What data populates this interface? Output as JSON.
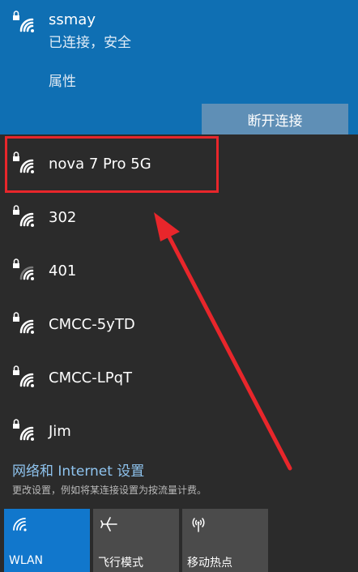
{
  "connected": {
    "name": "ssmay",
    "status": "已连接，安全",
    "properties_label": "属性",
    "disconnect_label": "断开连接"
  },
  "networks": [
    {
      "name": "nova 7 Pro 5G",
      "icon": "wifi-lock-icon"
    },
    {
      "name": "302",
      "icon": "wifi-lock-icon"
    },
    {
      "name": "401",
      "icon": "wifi-lock-icon"
    },
    {
      "name": "CMCC-5yTD",
      "icon": "wifi-lock-icon"
    },
    {
      "name": "CMCC-LPqT",
      "icon": "wifi-lock-icon"
    },
    {
      "name": "Jim",
      "icon": "wifi-lock-icon"
    }
  ],
  "settings": {
    "link": "网络和 Internet 设置",
    "description": "更改设置，例如将某连接设置为按流量计费。"
  },
  "quick_actions": [
    {
      "label": "WLAN",
      "icon": "wifi-icon",
      "active": true
    },
    {
      "label": "飞行模式",
      "icon": "airplane-icon",
      "active": false
    },
    {
      "label": "移动热点",
      "icon": "hotspot-icon",
      "active": false
    }
  ],
  "colors": {
    "accent": "#0f6fb3",
    "annotation": "#e8262b",
    "background": "#2b2b2b"
  }
}
